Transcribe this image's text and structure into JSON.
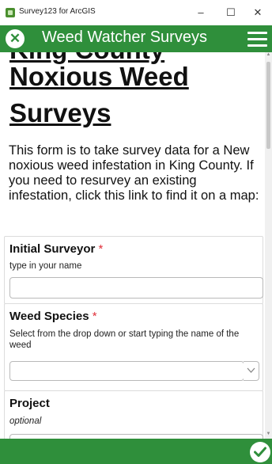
{
  "window": {
    "app_title": "Survey123 for ArcGIS",
    "minimize": "–",
    "maximize": "☐",
    "close": "✕"
  },
  "header": {
    "title": "Weed Watcher Surveys",
    "close_icon": "close-icon",
    "menu_icon": "menu-icon"
  },
  "form": {
    "heading_lines": [
      "King County",
      "Noxious Weed",
      "Surveys"
    ],
    "intro": "This form is to take survey data for a New noxious weed infestation in King County. If you need to resurvey an existing infestation, click this link to find it on a map:",
    "questions": [
      {
        "label": "Initial Surveyor",
        "required_mark": "*",
        "hint": "type in your name",
        "value": ""
      },
      {
        "label": "Weed Species",
        "required_mark": "*",
        "hint": "Select from the drop down or start typing the name of the weed",
        "value": ""
      },
      {
        "label": "Project",
        "required_mark": "",
        "hint": "optional",
        "value": ""
      }
    ]
  },
  "footer": {
    "submit_icon": "check-icon"
  },
  "colors": {
    "brand_green": "#2f8f3b",
    "required_red": "#e0303a"
  }
}
